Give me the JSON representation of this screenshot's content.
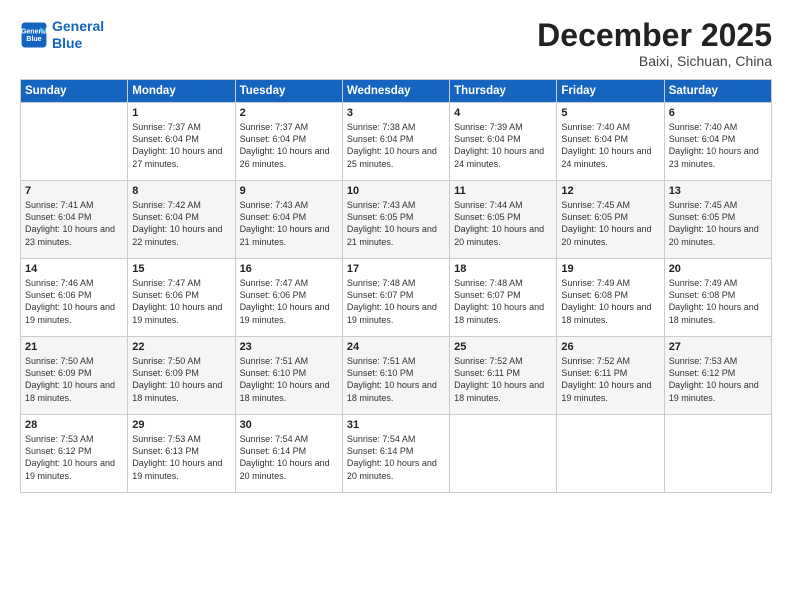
{
  "logo": {
    "line1": "General",
    "line2": "Blue"
  },
  "header": {
    "month": "December 2025",
    "location": "Baixi, Sichuan, China"
  },
  "weekdays": [
    "Sunday",
    "Monday",
    "Tuesday",
    "Wednesday",
    "Thursday",
    "Friday",
    "Saturday"
  ],
  "weeks": [
    [
      {
        "day": "",
        "sunrise": "",
        "sunset": "",
        "daylight": ""
      },
      {
        "day": "1",
        "sunrise": "Sunrise: 7:37 AM",
        "sunset": "Sunset: 6:04 PM",
        "daylight": "Daylight: 10 hours and 27 minutes."
      },
      {
        "day": "2",
        "sunrise": "Sunrise: 7:37 AM",
        "sunset": "Sunset: 6:04 PM",
        "daylight": "Daylight: 10 hours and 26 minutes."
      },
      {
        "day": "3",
        "sunrise": "Sunrise: 7:38 AM",
        "sunset": "Sunset: 6:04 PM",
        "daylight": "Daylight: 10 hours and 25 minutes."
      },
      {
        "day": "4",
        "sunrise": "Sunrise: 7:39 AM",
        "sunset": "Sunset: 6:04 PM",
        "daylight": "Daylight: 10 hours and 24 minutes."
      },
      {
        "day": "5",
        "sunrise": "Sunrise: 7:40 AM",
        "sunset": "Sunset: 6:04 PM",
        "daylight": "Daylight: 10 hours and 24 minutes."
      },
      {
        "day": "6",
        "sunrise": "Sunrise: 7:40 AM",
        "sunset": "Sunset: 6:04 PM",
        "daylight": "Daylight: 10 hours and 23 minutes."
      }
    ],
    [
      {
        "day": "7",
        "sunrise": "Sunrise: 7:41 AM",
        "sunset": "Sunset: 6:04 PM",
        "daylight": "Daylight: 10 hours and 23 minutes."
      },
      {
        "day": "8",
        "sunrise": "Sunrise: 7:42 AM",
        "sunset": "Sunset: 6:04 PM",
        "daylight": "Daylight: 10 hours and 22 minutes."
      },
      {
        "day": "9",
        "sunrise": "Sunrise: 7:43 AM",
        "sunset": "Sunset: 6:04 PM",
        "daylight": "Daylight: 10 hours and 21 minutes."
      },
      {
        "day": "10",
        "sunrise": "Sunrise: 7:43 AM",
        "sunset": "Sunset: 6:05 PM",
        "daylight": "Daylight: 10 hours and 21 minutes."
      },
      {
        "day": "11",
        "sunrise": "Sunrise: 7:44 AM",
        "sunset": "Sunset: 6:05 PM",
        "daylight": "Daylight: 10 hours and 20 minutes."
      },
      {
        "day": "12",
        "sunrise": "Sunrise: 7:45 AM",
        "sunset": "Sunset: 6:05 PM",
        "daylight": "Daylight: 10 hours and 20 minutes."
      },
      {
        "day": "13",
        "sunrise": "Sunrise: 7:45 AM",
        "sunset": "Sunset: 6:05 PM",
        "daylight": "Daylight: 10 hours and 20 minutes."
      }
    ],
    [
      {
        "day": "14",
        "sunrise": "Sunrise: 7:46 AM",
        "sunset": "Sunset: 6:06 PM",
        "daylight": "Daylight: 10 hours and 19 minutes."
      },
      {
        "day": "15",
        "sunrise": "Sunrise: 7:47 AM",
        "sunset": "Sunset: 6:06 PM",
        "daylight": "Daylight: 10 hours and 19 minutes."
      },
      {
        "day": "16",
        "sunrise": "Sunrise: 7:47 AM",
        "sunset": "Sunset: 6:06 PM",
        "daylight": "Daylight: 10 hours and 19 minutes."
      },
      {
        "day": "17",
        "sunrise": "Sunrise: 7:48 AM",
        "sunset": "Sunset: 6:07 PM",
        "daylight": "Daylight: 10 hours and 19 minutes."
      },
      {
        "day": "18",
        "sunrise": "Sunrise: 7:48 AM",
        "sunset": "Sunset: 6:07 PM",
        "daylight": "Daylight: 10 hours and 18 minutes."
      },
      {
        "day": "19",
        "sunrise": "Sunrise: 7:49 AM",
        "sunset": "Sunset: 6:08 PM",
        "daylight": "Daylight: 10 hours and 18 minutes."
      },
      {
        "day": "20",
        "sunrise": "Sunrise: 7:49 AM",
        "sunset": "Sunset: 6:08 PM",
        "daylight": "Daylight: 10 hours and 18 minutes."
      }
    ],
    [
      {
        "day": "21",
        "sunrise": "Sunrise: 7:50 AM",
        "sunset": "Sunset: 6:09 PM",
        "daylight": "Daylight: 10 hours and 18 minutes."
      },
      {
        "day": "22",
        "sunrise": "Sunrise: 7:50 AM",
        "sunset": "Sunset: 6:09 PM",
        "daylight": "Daylight: 10 hours and 18 minutes."
      },
      {
        "day": "23",
        "sunrise": "Sunrise: 7:51 AM",
        "sunset": "Sunset: 6:10 PM",
        "daylight": "Daylight: 10 hours and 18 minutes."
      },
      {
        "day": "24",
        "sunrise": "Sunrise: 7:51 AM",
        "sunset": "Sunset: 6:10 PM",
        "daylight": "Daylight: 10 hours and 18 minutes."
      },
      {
        "day": "25",
        "sunrise": "Sunrise: 7:52 AM",
        "sunset": "Sunset: 6:11 PM",
        "daylight": "Daylight: 10 hours and 18 minutes."
      },
      {
        "day": "26",
        "sunrise": "Sunrise: 7:52 AM",
        "sunset": "Sunset: 6:11 PM",
        "daylight": "Daylight: 10 hours and 19 minutes."
      },
      {
        "day": "27",
        "sunrise": "Sunrise: 7:53 AM",
        "sunset": "Sunset: 6:12 PM",
        "daylight": "Daylight: 10 hours and 19 minutes."
      }
    ],
    [
      {
        "day": "28",
        "sunrise": "Sunrise: 7:53 AM",
        "sunset": "Sunset: 6:12 PM",
        "daylight": "Daylight: 10 hours and 19 minutes."
      },
      {
        "day": "29",
        "sunrise": "Sunrise: 7:53 AM",
        "sunset": "Sunset: 6:13 PM",
        "daylight": "Daylight: 10 hours and 19 minutes."
      },
      {
        "day": "30",
        "sunrise": "Sunrise: 7:54 AM",
        "sunset": "Sunset: 6:14 PM",
        "daylight": "Daylight: 10 hours and 20 minutes."
      },
      {
        "day": "31",
        "sunrise": "Sunrise: 7:54 AM",
        "sunset": "Sunset: 6:14 PM",
        "daylight": "Daylight: 10 hours and 20 minutes."
      },
      {
        "day": "",
        "sunrise": "",
        "sunset": "",
        "daylight": ""
      },
      {
        "day": "",
        "sunrise": "",
        "sunset": "",
        "daylight": ""
      },
      {
        "day": "",
        "sunrise": "",
        "sunset": "",
        "daylight": ""
      }
    ]
  ]
}
